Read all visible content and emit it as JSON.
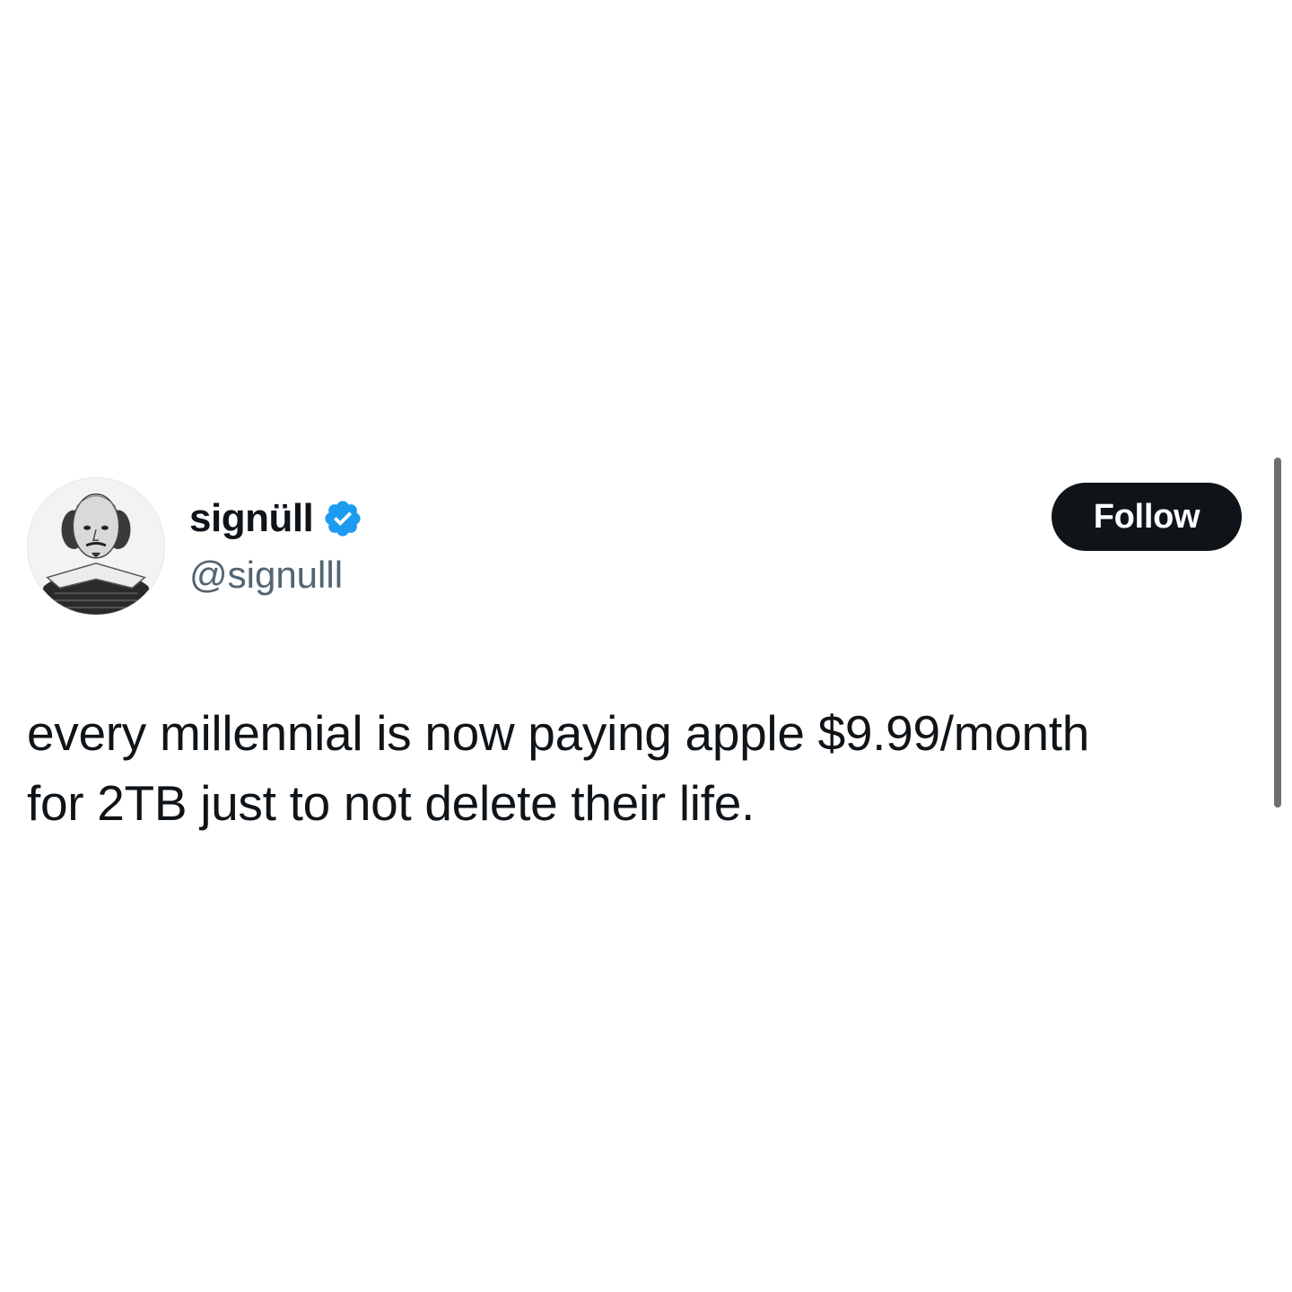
{
  "tweet": {
    "author": {
      "display_name": "signüll",
      "handle": "@signulll",
      "verified": true,
      "verified_color": "#1d9bf0",
      "avatar_icon": "engraved-portrait-avatar"
    },
    "follow_button": {
      "label": "Follow",
      "background": "#0f1419",
      "text_color": "#ffffff"
    },
    "text_lines": [
      "every millennial is now paying apple $9.99/month",
      "for 2TB just to not delete their life."
    ]
  },
  "colors": {
    "background": "#ffffff",
    "primary_text": "#0f1419",
    "secondary_text": "#536471"
  }
}
